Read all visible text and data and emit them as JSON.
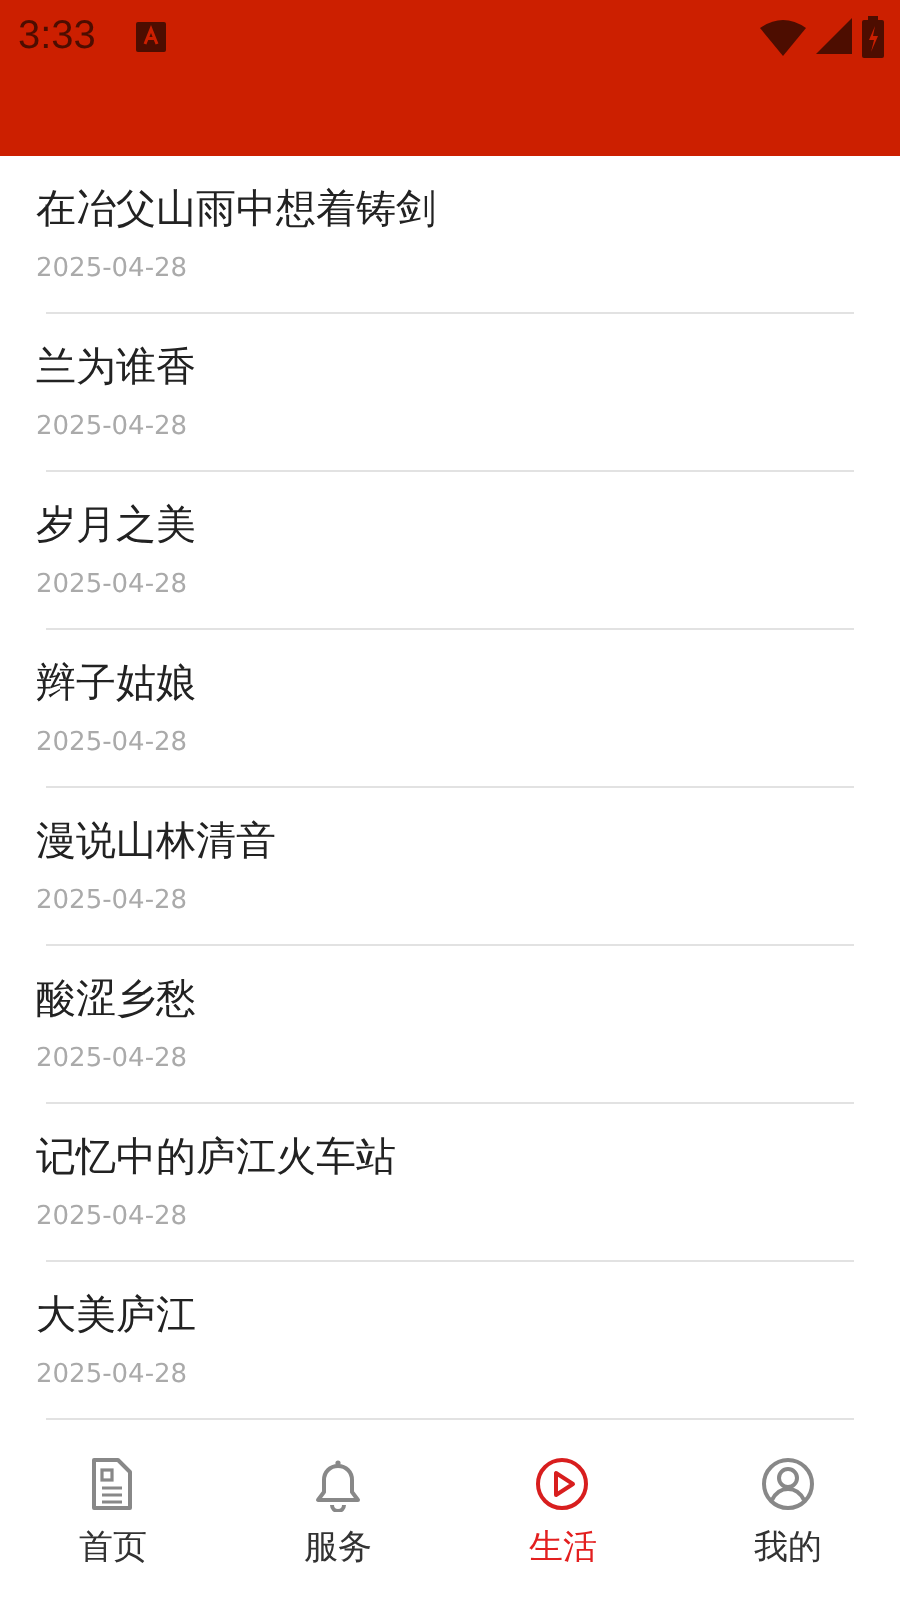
{
  "status_bar": {
    "time": "3:33"
  },
  "articles": [
    {
      "title": "在冶父山雨中想着铸剑",
      "date": "2025-04-28"
    },
    {
      "title": "兰为谁香",
      "date": "2025-04-28"
    },
    {
      "title": "岁月之美",
      "date": "2025-04-28"
    },
    {
      "title": "辫子姑娘",
      "date": "2025-04-28"
    },
    {
      "title": "漫说山林清音",
      "date": "2025-04-28"
    },
    {
      "title": "酸涩乡愁",
      "date": "2025-04-28"
    },
    {
      "title": "记忆中的庐江火车站",
      "date": "2025-04-28"
    },
    {
      "title": "大美庐江",
      "date": "2025-04-28"
    }
  ],
  "bottom_nav": [
    {
      "label": "首页",
      "selected": false
    },
    {
      "label": "服务",
      "selected": false
    },
    {
      "label": "生活",
      "selected": true
    },
    {
      "label": "我的",
      "selected": false
    }
  ]
}
